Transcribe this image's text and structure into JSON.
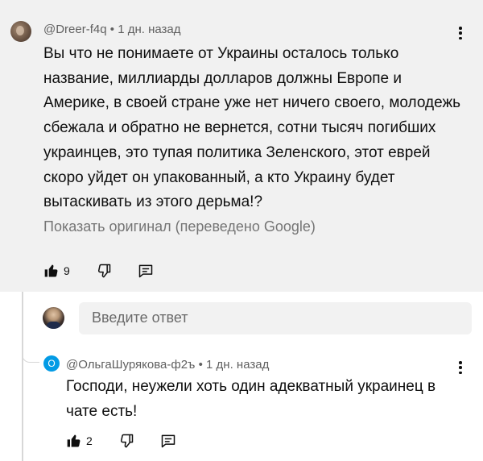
{
  "top_comment": {
    "author": "@Dreer-f4q",
    "separator": "•",
    "time": "1 дн. назад",
    "text": "Вы что не понимаете от Украины осталось только название, миллиарды долларов должны Европе и Америке, в своей стране уже нет ничего своего, молодежь сбежала и обратно не вернется, сотни тысяч погибших украинцев, это тупая политика Зеленского, этот еврей скоро уйдет он упакованный, а кто Украину будет вытаскивать из этого дерьма!?",
    "translate_link": "Показать оригинал (переведено Google)",
    "likes": "9",
    "background": "#f1f1f1"
  },
  "reply_box": {
    "placeholder": "Введите ответ"
  },
  "reply": {
    "avatar_letter": "О",
    "avatar_color": "#039be5",
    "author": "@ОльгаШурякова-ф2ъ",
    "separator": "•",
    "time": "1 дн. назад",
    "text": "Господи, неужели хоть один адекватный украинец в чате есть!",
    "likes": "2"
  },
  "icons": {
    "like": "thumbs-up-icon",
    "dislike": "thumbs-down-icon",
    "reply": "comment-reply-icon",
    "menu": "kebab-menu-icon"
  }
}
